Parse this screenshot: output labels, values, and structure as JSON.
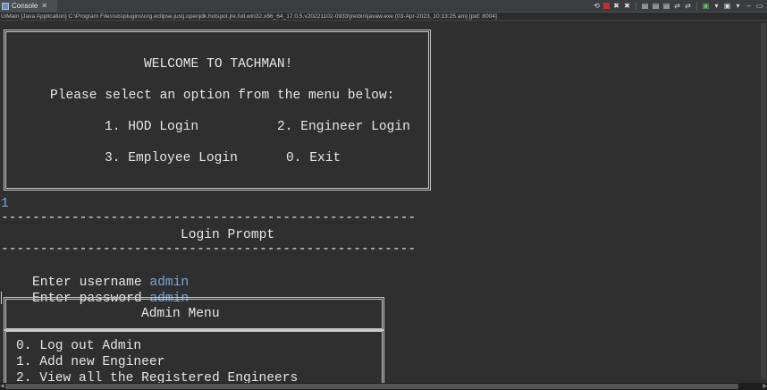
{
  "tab": {
    "label": "Console",
    "close": "✕"
  },
  "toolbar": {
    "icons": [
      "remove-launch-icon",
      "terminate-icon",
      "remove-all-icon",
      "pin-icon",
      "scroll-lock-icon",
      "word-wrap-icon",
      "show-on-output-icon",
      "show-on-error-icon",
      "display-console-icon",
      "open-console-icon",
      "minimize-icon",
      "maximize-icon"
    ]
  },
  "infobar": {
    "text": "UiMain [Java Application] C:\\Program Files\\sts\\plugins\\org.eclipse.justj.openjdk.hotspot.jre.full.win32.x86_64_17.0.5.v20221102-0933\\jre\\bin\\javaw.exe  (03-Apr-2023, 10:13:25 am) [pid: 8004]"
  },
  "welcome": {
    "title": "WELCOME TO TACHMAN!",
    "prompt": "Please select an option from the menu below:",
    "opt1": "1. HOD Login",
    "opt2": "2. Engineer Login",
    "opt3": "3. Employee Login",
    "opt0": "0. Exit"
  },
  "console": {
    "input_choice": "1",
    "divider": "-----------------------------------------------------",
    "login_title": "Login Prompt",
    "username_label": "Enter username ",
    "username_value": "admin",
    "password_label": "Enter password ",
    "password_value": "admin"
  },
  "admin_menu": {
    "title": "Admin Menu",
    "items": [
      "0. Log out Admin",
      "1. Add new Engineer",
      "2. View all the Registered Engineers"
    ]
  }
}
